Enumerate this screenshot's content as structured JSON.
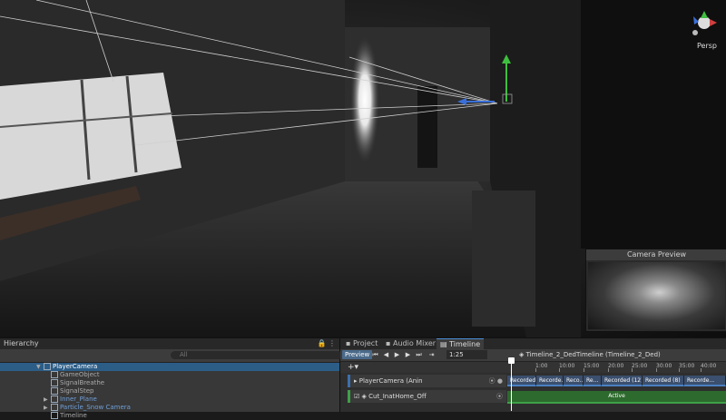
{
  "scene_view": {
    "gizmo_label": "Persp",
    "axis_colors": {
      "y": "#3fbf3f",
      "x": "#d04040",
      "z": "#3a6fd8"
    }
  },
  "camera_preview": {
    "title": "Camera Preview"
  },
  "hierarchy": {
    "title": "Hierarchy",
    "search_placeholder": "All",
    "rows": [
      {
        "label": "PlayerCamera",
        "type": "selected"
      },
      {
        "label": "GameObject",
        "type": "child"
      },
      {
        "label": "SignalBreathe",
        "type": "child"
      },
      {
        "label": "SignalStep",
        "type": "child"
      },
      {
        "label": "Inner_Plane",
        "type": "prefab"
      },
      {
        "label": "Particle_Snow Camera",
        "type": "prefab"
      },
      {
        "label": "Timeline",
        "type": "child"
      }
    ]
  },
  "timeline": {
    "tabs": [
      "Project",
      "Audio Mixer",
      "Timeline"
    ],
    "preview_label": "Preview",
    "frame": "1:25",
    "asset_name": "Timeline_2_DedTimeline (Timeline_2_Ded)",
    "add_label": "+▾",
    "ruler_ticks": [
      "1:00",
      "10:00",
      "15:00",
      "20:00",
      "25:00",
      "30:00",
      "35:00",
      "40:00"
    ],
    "tracks": [
      {
        "label": "PlayerCamera (Anin",
        "kind": "animation"
      },
      {
        "label": "Cut_InatHome_Off",
        "kind": "activation"
      }
    ],
    "animation_clips": [
      "Recorded",
      "Recorde...",
      "Reco...",
      "Re...",
      "Recorded (12)",
      "Recorded (8)",
      "Recorde..."
    ],
    "activation_clip": "Active"
  }
}
